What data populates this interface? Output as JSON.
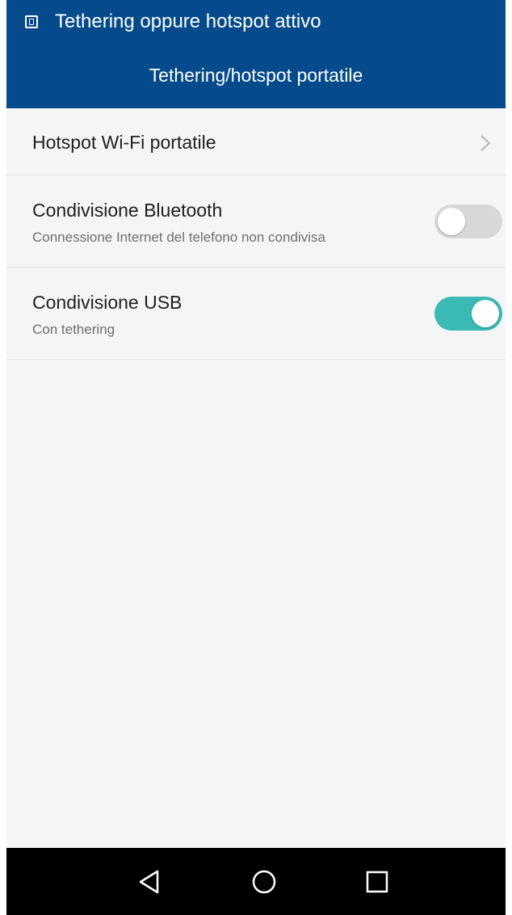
{
  "status_bar": {
    "notification_icon": "tethering-notification-icon",
    "text": "Tethering oppure hotspot attivo"
  },
  "toolbar": {
    "title": "Tethering/hotspot portatile"
  },
  "settings": {
    "hotspot": {
      "title": "Hotspot Wi-Fi portatile",
      "icon": "chevron-right-icon"
    },
    "bluetooth": {
      "title": "Condivisione Bluetooth",
      "subtitle": "Connessione Internet del telefono non condivisa",
      "enabled": false
    },
    "usb": {
      "title": "Condivisione USB",
      "subtitle": "Con tethering",
      "enabled": true
    }
  },
  "colors": {
    "header": "#054a8a",
    "toggle_on": "#3ab9b5",
    "toggle_off": "#d8d8d8",
    "background": "#f5f5f5"
  },
  "nav_bar": {
    "back_icon": "back-triangle-icon",
    "home_icon": "home-circle-icon",
    "recents_icon": "recents-square-icon"
  }
}
